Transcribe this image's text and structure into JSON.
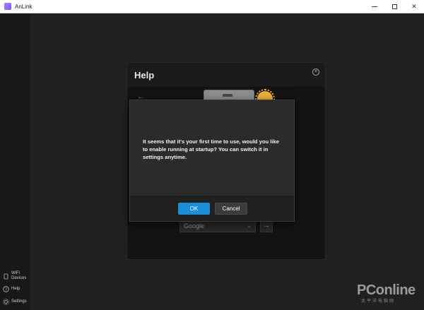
{
  "window": {
    "title": "AnLink",
    "icon": "anlink-app-icon",
    "controls": {
      "minimize": "—",
      "maximize": "☐",
      "close": "✕"
    }
  },
  "sidebar": {
    "items": [
      {
        "label": "WiFi Devices",
        "icon": "wifi-devices-icon"
      },
      {
        "label": "Help",
        "icon": "help-icon"
      },
      {
        "label": "Settings",
        "icon": "gear-icon"
      }
    ]
  },
  "help_panel": {
    "title": "Help",
    "close_glyph": "×",
    "back_glyph": "←",
    "search_engine": "Google",
    "go_glyph": "→"
  },
  "dialog": {
    "message": "It seems that it's your first time to use, would you like to enable running at startup? You can switch it in settings anytime.",
    "ok_label": "OK",
    "cancel_label": "Cancel"
  },
  "watermark": {
    "logo": "PConline",
    "subtitle": "太平洋电脑网"
  },
  "colors": {
    "accent": "#1a8fd6",
    "background": "#1f1f1f",
    "dialog": "#2b2b2b"
  }
}
